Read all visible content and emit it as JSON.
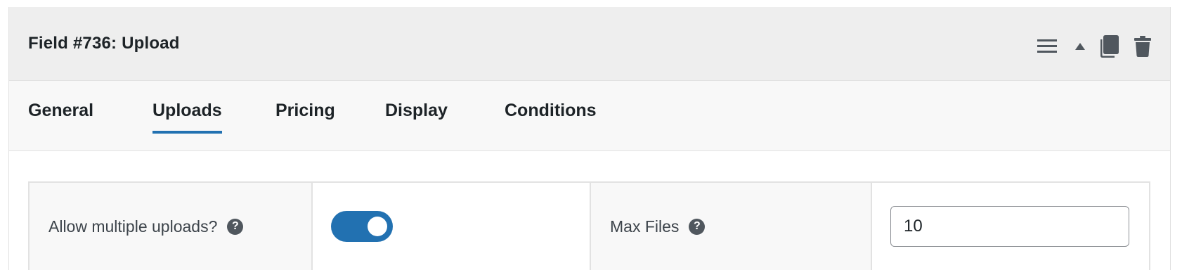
{
  "header": {
    "title": "Field #736: Upload",
    "actions": [
      {
        "icon": "menu-icon"
      },
      {
        "icon": "caret-up-icon"
      },
      {
        "icon": "duplicate-icon"
      },
      {
        "icon": "trash-icon"
      }
    ]
  },
  "tabs": [
    {
      "label": "General",
      "active": false
    },
    {
      "label": "Uploads",
      "active": true
    },
    {
      "label": "Pricing",
      "active": false
    },
    {
      "label": "Display",
      "active": false
    },
    {
      "label": "Conditions",
      "active": false
    }
  ],
  "fields": {
    "allow_multiple": {
      "label": "Allow multiple uploads?",
      "help": "?",
      "enabled": true
    },
    "max_files": {
      "label": "Max Files",
      "help": "?",
      "value": "10"
    }
  },
  "colors": {
    "accent": "#2271b1",
    "header_bg": "#eeeeee",
    "tabs_bg": "#f8f8f8",
    "icon_gray": "#50575e"
  }
}
